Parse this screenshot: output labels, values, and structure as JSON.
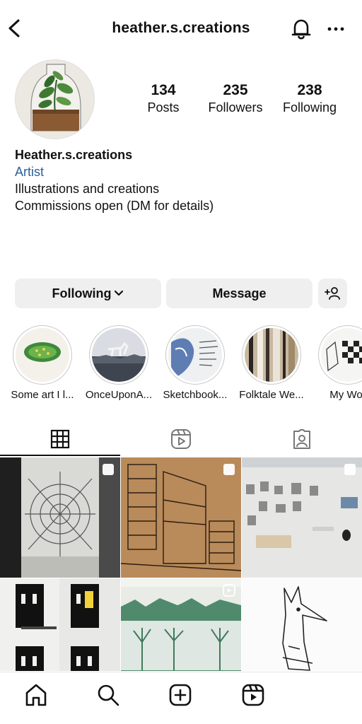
{
  "header": {
    "username": "heather.s.creations",
    "back_icon": "chevron-left-icon",
    "notify_icon": "bell-icon",
    "more_icon": "more-horizontal-icon"
  },
  "stats": {
    "posts": {
      "value": "134",
      "label": "Posts"
    },
    "followers": {
      "value": "235",
      "label": "Followers"
    },
    "following": {
      "value": "238",
      "label": "Following"
    }
  },
  "bio": {
    "display_name": "Heather.s.creations",
    "category": "Artist",
    "lines": [
      "Illustrations and creations",
      "Commissions open (DM for details)"
    ]
  },
  "actions": {
    "following_label": "Following",
    "message_label": "Message",
    "add_user_icon": "add-user-icon"
  },
  "highlights": [
    {
      "label": "Some art I l..."
    },
    {
      "label": "OnceUponA..."
    },
    {
      "label": "Sketchbook..."
    },
    {
      "label": "Folktale We..."
    },
    {
      "label": "My Wor"
    }
  ],
  "tabs": [
    {
      "name": "grid-icon",
      "active": true
    },
    {
      "name": "reels-icon",
      "active": false
    },
    {
      "name": "tagged-icon",
      "active": false
    }
  ],
  "bottom_nav": [
    {
      "name": "home-icon"
    },
    {
      "name": "search-icon"
    },
    {
      "name": "create-icon"
    },
    {
      "name": "reels-icon"
    }
  ],
  "colors": {
    "link": "#2b5f97",
    "button_bg": "#efefef",
    "text": "#111111"
  }
}
